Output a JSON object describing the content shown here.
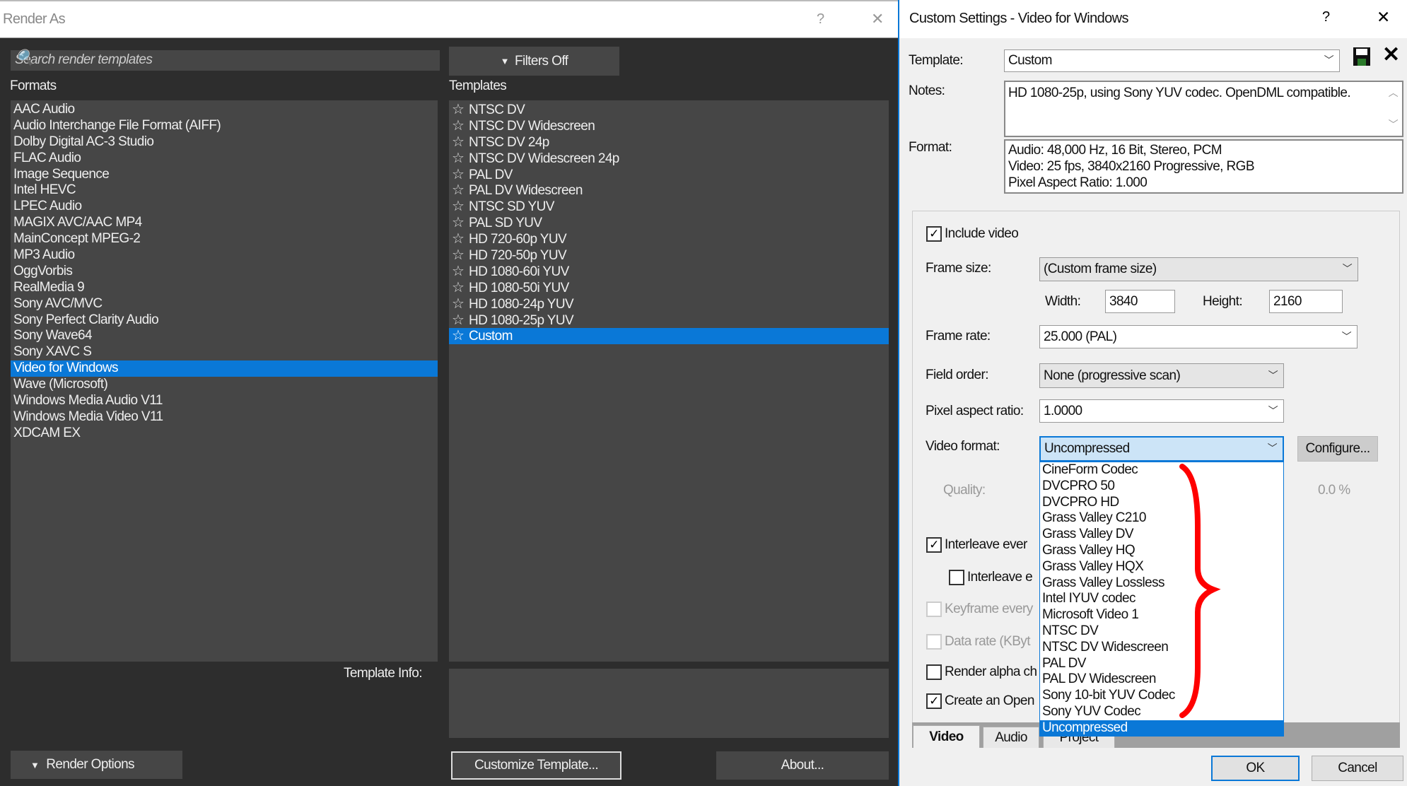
{
  "render_as": {
    "title": "Render As",
    "help": "?",
    "close": "✕",
    "search_placeholder": "Search render templates",
    "filters_label": "Filters Off",
    "formats_label": "Formats",
    "templates_label": "Templates",
    "formats": [
      "AAC Audio",
      "Audio Interchange File Format (AIFF)",
      "Dolby Digital AC-3 Studio",
      "FLAC Audio",
      "Image Sequence",
      "Intel HEVC",
      "LPEC Audio",
      "MAGIX AVC/AAC MP4",
      "MainConcept MPEG-2",
      "MP3 Audio",
      "OggVorbis",
      "RealMedia 9",
      "Sony AVC/MVC",
      "Sony Perfect Clarity Audio",
      "Sony Wave64",
      "Sony XAVC S",
      "Video for Windows",
      "Wave (Microsoft)",
      "Windows Media Audio V11",
      "Windows Media Video V11",
      "XDCAM EX"
    ],
    "selected_format": "Video for Windows",
    "templates": [
      "NTSC DV",
      "NTSC DV Widescreen",
      "NTSC DV 24p",
      "NTSC DV Widescreen 24p",
      "PAL DV",
      "PAL DV Widescreen",
      "NTSC SD YUV",
      "PAL SD YUV",
      "HD 720-60p YUV",
      "HD 720-50p YUV",
      "HD 1080-60i YUV",
      "HD 1080-50i YUV",
      "HD 1080-24p YUV",
      "HD 1080-25p YUV",
      "Custom"
    ],
    "selected_template": "Custom",
    "template_info_label": "Template Info:",
    "render_options_label": "Render Options",
    "customize_label": "Customize Template...",
    "about_label": "About..."
  },
  "custom": {
    "title": "Custom Settings - Video for Windows",
    "help": "?",
    "close": "✕",
    "template_label": "Template:",
    "template_value": "Custom",
    "notes_label": "Notes:",
    "notes_value": "HD 1080-25p, using Sony YUV codec. OpenDML compatible.",
    "format_label": "Format:",
    "format_lines": [
      "Audio: 48,000 Hz, 16 Bit, Stereo, PCM",
      "Video: 25 fps, 3840x2160 Progressive, RGB",
      "Pixel Aspect Ratio: 1.000"
    ],
    "include_video": "Include video",
    "frame_size_label": "Frame size:",
    "frame_size": "(Custom frame size)",
    "width_label": "Width:",
    "width": "3840",
    "height_label": "Height:",
    "height": "2160",
    "frame_rate_label": "Frame rate:",
    "frame_rate": "25.000 (PAL)",
    "field_order_label": "Field order:",
    "field_order": "None (progressive scan)",
    "par_label": "Pixel aspect ratio:",
    "par": "1.0000",
    "video_format_label": "Video format:",
    "video_format": "Uncompressed",
    "configure_label": "Configure...",
    "quality_label": "Quality:",
    "quality_value": "0.0 %",
    "interleave1": "Interleave ever",
    "interleave2": "Interleave e",
    "keyframe": "Keyframe every",
    "datarate": "Data rate (KByt",
    "render_alpha": "Render alpha ch",
    "create_open": "Create an Open",
    "video_format_options": [
      "CineForm Codec",
      "DVCPRO 50",
      "DVCPRO HD",
      "Grass Valley C210",
      "Grass Valley DV",
      "Grass Valley HQ",
      "Grass Valley HQX",
      "Grass Valley Lossless",
      "Intel IYUV codec",
      "Microsoft Video 1",
      "NTSC DV",
      "NTSC DV Widescreen",
      "PAL DV",
      "PAL DV Widescreen",
      "Sony 10-bit YUV Codec",
      "Sony YUV Codec",
      "Uncompressed"
    ],
    "tabs": [
      "Video",
      "Audio",
      "Project"
    ],
    "ok_label": "OK",
    "cancel_label": "Cancel",
    "annotation_color": "#ff0000",
    "accent": "#0a78d7"
  }
}
